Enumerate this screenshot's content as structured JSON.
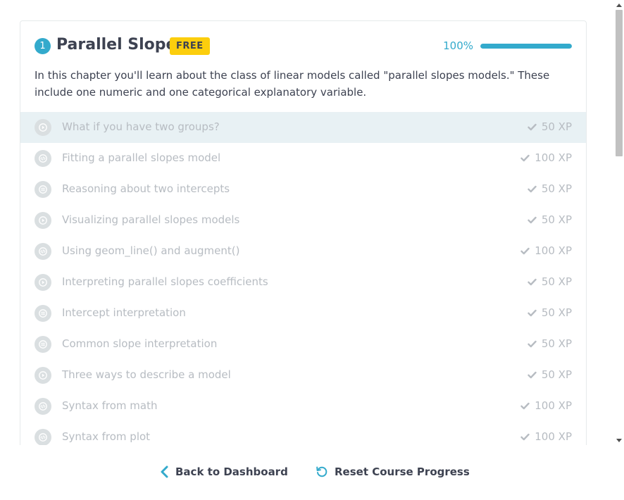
{
  "chapter": {
    "number": "1",
    "title": "Parallel Slopes",
    "badge": "FREE",
    "progress_text": "100%",
    "progress_value": 1.0,
    "description": "In this chapter you'll learn about the class of linear models called \"parallel slopes models.\" These include one numeric and one categorical explanatory variable."
  },
  "exercises": [
    {
      "title": "What if you have two groups?",
      "xp": "50 XP",
      "icon": "play-icon"
    },
    {
      "title": "Fitting a parallel slopes model",
      "xp": "100 XP",
      "icon": "code-icon"
    },
    {
      "title": "Reasoning about two intercepts",
      "xp": "50 XP",
      "icon": "list-icon"
    },
    {
      "title": "Visualizing parallel slopes models",
      "xp": "50 XP",
      "icon": "play-icon"
    },
    {
      "title": "Using geom_line() and augment()",
      "xp": "100 XP",
      "icon": "code-icon"
    },
    {
      "title": "Interpreting parallel slopes coefficients",
      "xp": "50 XP",
      "icon": "play-icon"
    },
    {
      "title": "Intercept interpretation",
      "xp": "50 XP",
      "icon": "list-icon"
    },
    {
      "title": "Common slope interpretation",
      "xp": "50 XP",
      "icon": "list-icon"
    },
    {
      "title": "Three ways to describe a model",
      "xp": "50 XP",
      "icon": "play-icon"
    },
    {
      "title": "Syntax from math",
      "xp": "100 XP",
      "icon": "code-icon"
    },
    {
      "title": "Syntax from plot",
      "xp": "100 XP",
      "icon": "code-icon"
    }
  ],
  "footer": {
    "back_label": "Back to Dashboard",
    "reset_label": "Reset Course Progress"
  },
  "colors": {
    "accent": "#33aacc",
    "badge": "#fcce0d",
    "text": "#3d4251",
    "muted": "#b7bcc2"
  }
}
